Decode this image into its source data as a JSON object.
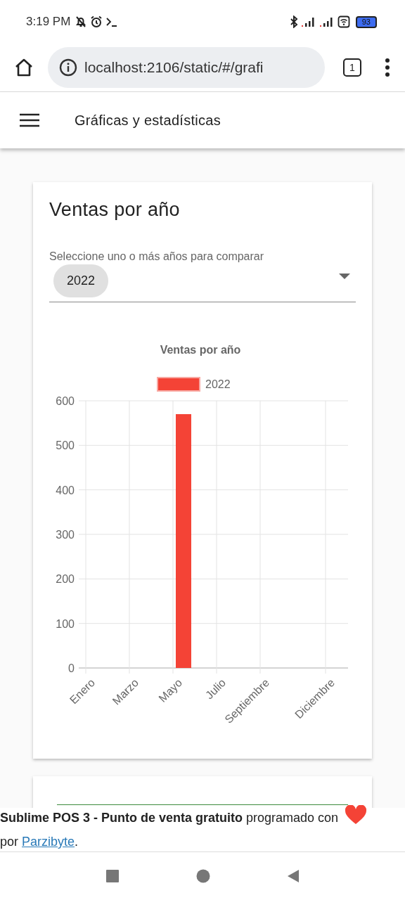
{
  "status_bar": {
    "time": "3:19 PM",
    "battery": "93"
  },
  "browser": {
    "url": "localhost:2106/static/#/grafi",
    "tab_count": "1"
  },
  "app_bar": {
    "title": "Gráficas y estadísticas"
  },
  "card": {
    "title": "Ventas por año",
    "select": {
      "label": "Seleccione uno o más años para comparar",
      "chips": [
        "2022"
      ]
    },
    "chart_data": {
      "type": "bar",
      "title": "Ventas por año",
      "categories": [
        "Enero",
        null,
        "Marzo",
        null,
        "Mayo",
        null,
        "Julio",
        null,
        "Septiembre",
        null,
        null,
        "Diciembre"
      ],
      "series": [
        {
          "name": "2022",
          "color": "#f44336",
          "values": [
            0,
            0,
            0,
            0,
            570,
            0,
            0,
            0,
            0,
            0,
            0,
            0
          ]
        }
      ],
      "grid": true,
      "ylim": [
        0,
        600
      ],
      "yticks": [
        0,
        100,
        200,
        300,
        400,
        500,
        600
      ]
    }
  },
  "footer": {
    "text": "**Sublime POS 3 - Punto de venta gratuito** programado con",
    "by": "por",
    "link": "Parzibyte",
    "end": "."
  }
}
